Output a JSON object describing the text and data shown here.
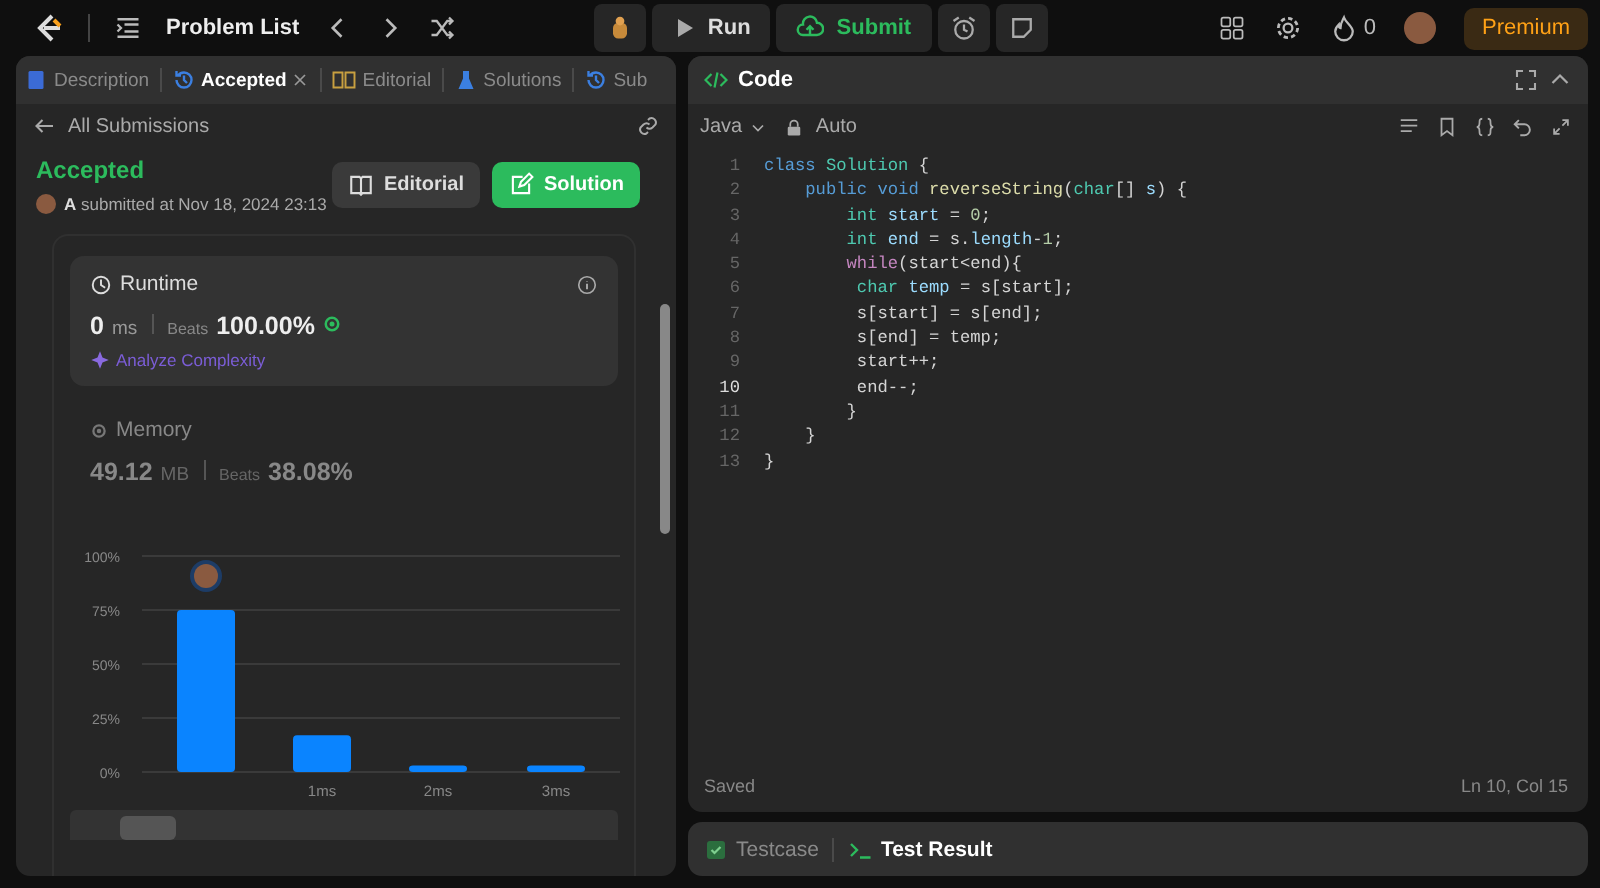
{
  "nav": {
    "problem_list": "Problem List",
    "run": "Run",
    "submit": "Submit",
    "streak": "0",
    "premium": "Premium"
  },
  "left_tabs": [
    {
      "label": "Description",
      "selected": false,
      "closable": false
    },
    {
      "label": "Accepted",
      "selected": true,
      "closable": true
    },
    {
      "label": "Editorial",
      "selected": false,
      "closable": false
    },
    {
      "label": "Solutions",
      "selected": false,
      "closable": false
    },
    {
      "label": "Sub",
      "selected": false,
      "closable": false
    }
  ],
  "back_link": "All Submissions",
  "submission": {
    "status": "Accepted",
    "submitted": "**A** submitted at Nov 18, 2024 23:13",
    "buttons": [
      {
        "label": "Editorial",
        "kind": "secondary"
      },
      {
        "label": "Solution",
        "kind": "primary"
      }
    ]
  },
  "runtime": {
    "title": "Runtime",
    "value": "0",
    "unit": "ms",
    "beats_label": "Beats",
    "beats": "100.00%",
    "analyze": "Analyze Complexity"
  },
  "memory": {
    "title": "Memory",
    "value": "49.12",
    "unit": "MB",
    "beats_label": "Beats",
    "beats": "38.08%"
  },
  "distribution": {
    "chart_data": {
      "type": "bar",
      "categories": [
        null,
        "1ms",
        "2ms",
        "3ms"
      ],
      "values": [
        75,
        17,
        3,
        3
      ],
      "grid": true,
      "ylim": [
        0,
        100
      ],
      "yticks": [
        {
          "value": 0,
          "label": "0%"
        },
        {
          "value": 25,
          "label": "25%"
        },
        {
          "value": 50,
          "label": "50%"
        },
        {
          "value": 75,
          "label": "75%"
        },
        {
          "value": 100,
          "label": "100%"
        }
      ]
    }
  },
  "code_panel": {
    "title": "Code",
    "language": "Java",
    "mode": "Auto",
    "status": "Saved",
    "cursor": "Ln 10, Col 15",
    "lines": [
      {
        "number": "1",
        "current": false,
        "tokens": [
          {
            "kind": "keyword",
            "text": "class "
          },
          {
            "kind": "type",
            "text": "Solution"
          },
          {
            "kind": "plain",
            "text": " {"
          }
        ]
      },
      {
        "number": "2",
        "current": false,
        "tokens": [
          {
            "kind": "keyword",
            "text": "    public void "
          },
          {
            "kind": "function",
            "text": "reverseString"
          },
          {
            "kind": "plain",
            "text": "("
          },
          {
            "kind": "type",
            "text": "char"
          },
          {
            "kind": "plain",
            "text": "[] "
          },
          {
            "kind": "variable",
            "text": "s"
          },
          {
            "kind": "plain",
            "text": ") {"
          }
        ]
      },
      {
        "number": "3",
        "current": false,
        "tokens": [
          {
            "kind": "type",
            "text": "        int "
          },
          {
            "kind": "variable",
            "text": "start"
          },
          {
            "kind": "plain",
            "text": " = "
          },
          {
            "kind": "number",
            "text": "0"
          },
          {
            "kind": "plain",
            "text": ";"
          }
        ]
      },
      {
        "number": "4",
        "current": false,
        "tokens": [
          {
            "kind": "type",
            "text": "        int "
          },
          {
            "kind": "variable",
            "text": "end"
          },
          {
            "kind": "plain",
            "text": " = s."
          },
          {
            "kind": "variable",
            "text": "length"
          },
          {
            "kind": "plain",
            "text": "-"
          },
          {
            "kind": "number",
            "text": "1"
          },
          {
            "kind": "plain",
            "text": ";"
          }
        ]
      },
      {
        "number": "5",
        "current": false,
        "tokens": [
          {
            "kind": "control",
            "text": "        while"
          },
          {
            "kind": "plain",
            "text": "(start<end){"
          }
        ]
      },
      {
        "number": "6",
        "current": false,
        "tokens": [
          {
            "kind": "type",
            "text": "         char "
          },
          {
            "kind": "variable",
            "text": "temp"
          },
          {
            "kind": "plain",
            "text": " = s[start];"
          }
        ]
      },
      {
        "number": "7",
        "current": false,
        "tokens": [
          {
            "kind": "plain",
            "text": "         s[start] = s[end];"
          }
        ]
      },
      {
        "number": "8",
        "current": false,
        "tokens": [
          {
            "kind": "plain",
            "text": "         s[end] = temp;"
          }
        ]
      },
      {
        "number": "9",
        "current": false,
        "tokens": [
          {
            "kind": "plain",
            "text": "         start++;"
          }
        ]
      },
      {
        "number": "10",
        "current": true,
        "tokens": [
          {
            "kind": "plain",
            "text": "         end--;"
          }
        ]
      },
      {
        "number": "11",
        "current": false,
        "tokens": [
          {
            "kind": "plain",
            "text": "        }"
          }
        ]
      },
      {
        "number": "12",
        "current": false,
        "tokens": [
          {
            "kind": "plain",
            "text": "    }"
          }
        ]
      },
      {
        "number": "13",
        "current": false,
        "tokens": [
          {
            "kind": "plain",
            "text": "}"
          }
        ]
      }
    ]
  },
  "result_tabs": [
    {
      "label": "Testcase",
      "selected": false
    },
    {
      "label": "Test Result",
      "selected": true
    }
  ]
}
